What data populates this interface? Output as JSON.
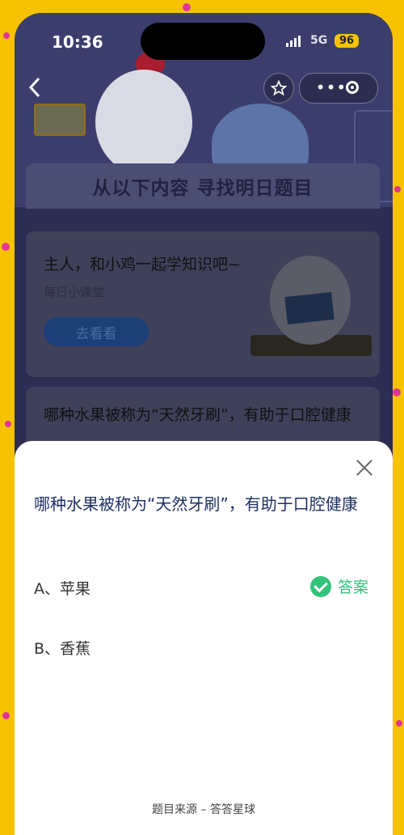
{
  "status": {
    "time": "10:36",
    "network": "5G",
    "battery": "96"
  },
  "nav": {
    "back_icon": "chevron-left-icon",
    "star_icon": "star-icon",
    "more_icon": "more-dots-icon",
    "record_icon": "record-circle-icon"
  },
  "banner": {
    "title": "从以下内容 寻找明日题目"
  },
  "card1": {
    "title": "主人，和小鸡一起学知识吧~",
    "subtitle": "每日小课堂",
    "button": "去看看"
  },
  "card2": {
    "question": "哪种水果被称为“天然牙刷”，有助于口腔健康"
  },
  "sheet": {
    "question": "哪种水果被称为“天然牙刷”，有助于口腔健康",
    "options": [
      {
        "label": "A、苹果",
        "correct": true
      },
      {
        "label": "B、香蕉",
        "correct": false
      }
    ],
    "answer_label": "答案",
    "source": "题目来源 – 答答星球"
  },
  "colors": {
    "accent_green": "#33c27a",
    "question_blue": "#1e3060",
    "background_yellow": "#f7c300"
  }
}
